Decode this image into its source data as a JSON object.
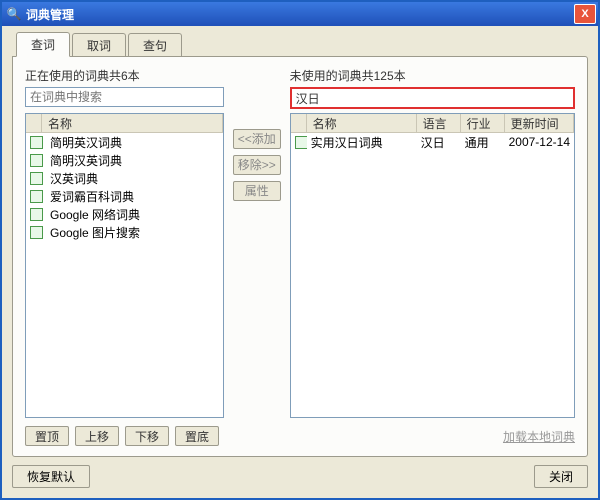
{
  "window": {
    "title": "词典管理",
    "close": "X"
  },
  "tabs": [
    {
      "label": "查词",
      "active": true
    },
    {
      "label": "取词",
      "active": false
    },
    {
      "label": "查句",
      "active": false
    }
  ],
  "left": {
    "label": "正在使用的词典共6本",
    "search_placeholder": "在词典中搜索",
    "headers": {
      "name": "名称"
    },
    "items": [
      "简明英汉词典",
      "简明汉英词典",
      "汉英词典",
      "爱词霸百科词典",
      "Google 网络词典",
      "Google 图片搜索"
    ]
  },
  "right": {
    "label": "未使用的词典共125本",
    "search_value": "汉日",
    "headers": {
      "name": "名称",
      "lang": "语言",
      "field": "行业",
      "updated": "更新时间"
    },
    "items": [
      {
        "name": "实用汉日词典",
        "lang": "汉日",
        "field": "通用",
        "updated": "2007-12-14"
      }
    ]
  },
  "mid_buttons": {
    "add": "<<添加",
    "remove": "移除>>",
    "props": "属性"
  },
  "bottom_buttons": {
    "top": "置顶",
    "up": "上移",
    "down": "下移",
    "bottom": "置底",
    "link": "加载本地词典"
  },
  "footer": {
    "restore": "恢复默认",
    "close": "关闭"
  }
}
